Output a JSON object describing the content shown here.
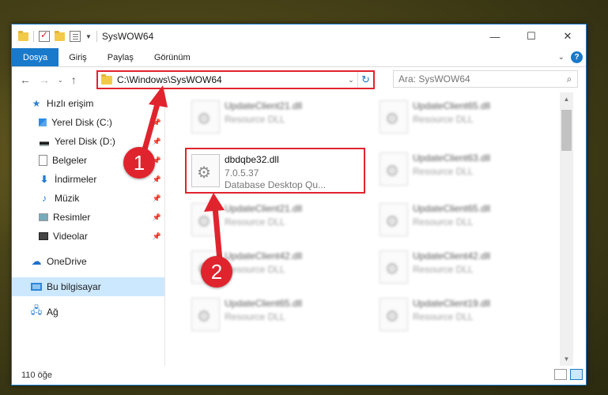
{
  "window": {
    "title": "SysWOW64",
    "controls": {
      "minimize": "—",
      "maximize": "☐",
      "close": "✕"
    }
  },
  "ribbon": {
    "tabs": [
      "Dosya",
      "Giriş",
      "Paylaş",
      "Görünüm"
    ],
    "help_label": "?"
  },
  "address": {
    "path": "C:\\Windows\\SysWOW64"
  },
  "search": {
    "placeholder": "Ara: SysWOW64"
  },
  "sidebar": {
    "items": [
      {
        "label": "Hızlı erişim",
        "icon": "star-icon",
        "pinned": false
      },
      {
        "label": "Yerel Disk (C:)",
        "icon": "windows-disk-icon",
        "pinned": true
      },
      {
        "label": "Yerel Disk (D:)",
        "icon": "disk-icon",
        "pinned": true
      },
      {
        "label": "Belgeler",
        "icon": "document-icon",
        "pinned": true
      },
      {
        "label": "İndirmeler",
        "icon": "download-icon",
        "pinned": true
      },
      {
        "label": "Müzik",
        "icon": "music-icon",
        "pinned": true
      },
      {
        "label": "Resimler",
        "icon": "pictures-icon",
        "pinned": true
      },
      {
        "label": "Videolar",
        "icon": "video-icon",
        "pinned": true
      },
      {
        "label": "OneDrive",
        "icon": "cloud-icon",
        "pinned": false
      },
      {
        "label": "Bu bilgisayar",
        "icon": "computer-icon",
        "pinned": false,
        "selected": true
      },
      {
        "label": "Ağ",
        "icon": "network-icon",
        "pinned": false
      }
    ]
  },
  "files": {
    "highlighted": {
      "name": "dbdqbe32.dll",
      "version": "7.0.5.37",
      "description": "Database Desktop Qu..."
    },
    "blurred": [
      {
        "name": "UpdateClient21.dll",
        "type": "Resource DLL"
      },
      {
        "name": "UpdateClient65.dll",
        "type": "Resource DLL"
      },
      {
        "name": "UpdateClient63.dll",
        "type": "Resource DLL"
      },
      {
        "name": "UpdateClient21.dll",
        "type": "Resource DLL"
      },
      {
        "name": "UpdateClient65.dll",
        "type": "Resource DLL"
      },
      {
        "name": "UpdateClient42.dll",
        "type": "Resource DLL"
      },
      {
        "name": "UpdateClient42.dll",
        "type": "Resource DLL"
      },
      {
        "name": "UpdateClient65.dll",
        "type": "Resource DLL"
      },
      {
        "name": "UpdateClient19.dll",
        "type": "Resource DLL"
      }
    ]
  },
  "status": {
    "item_count": "110 öğe"
  },
  "annotations": {
    "badge1": "1",
    "badge2": "2"
  },
  "colors": {
    "accent": "#1979ca",
    "annotation_red": "#e0242e",
    "selected_bg": "#cce8ff"
  }
}
